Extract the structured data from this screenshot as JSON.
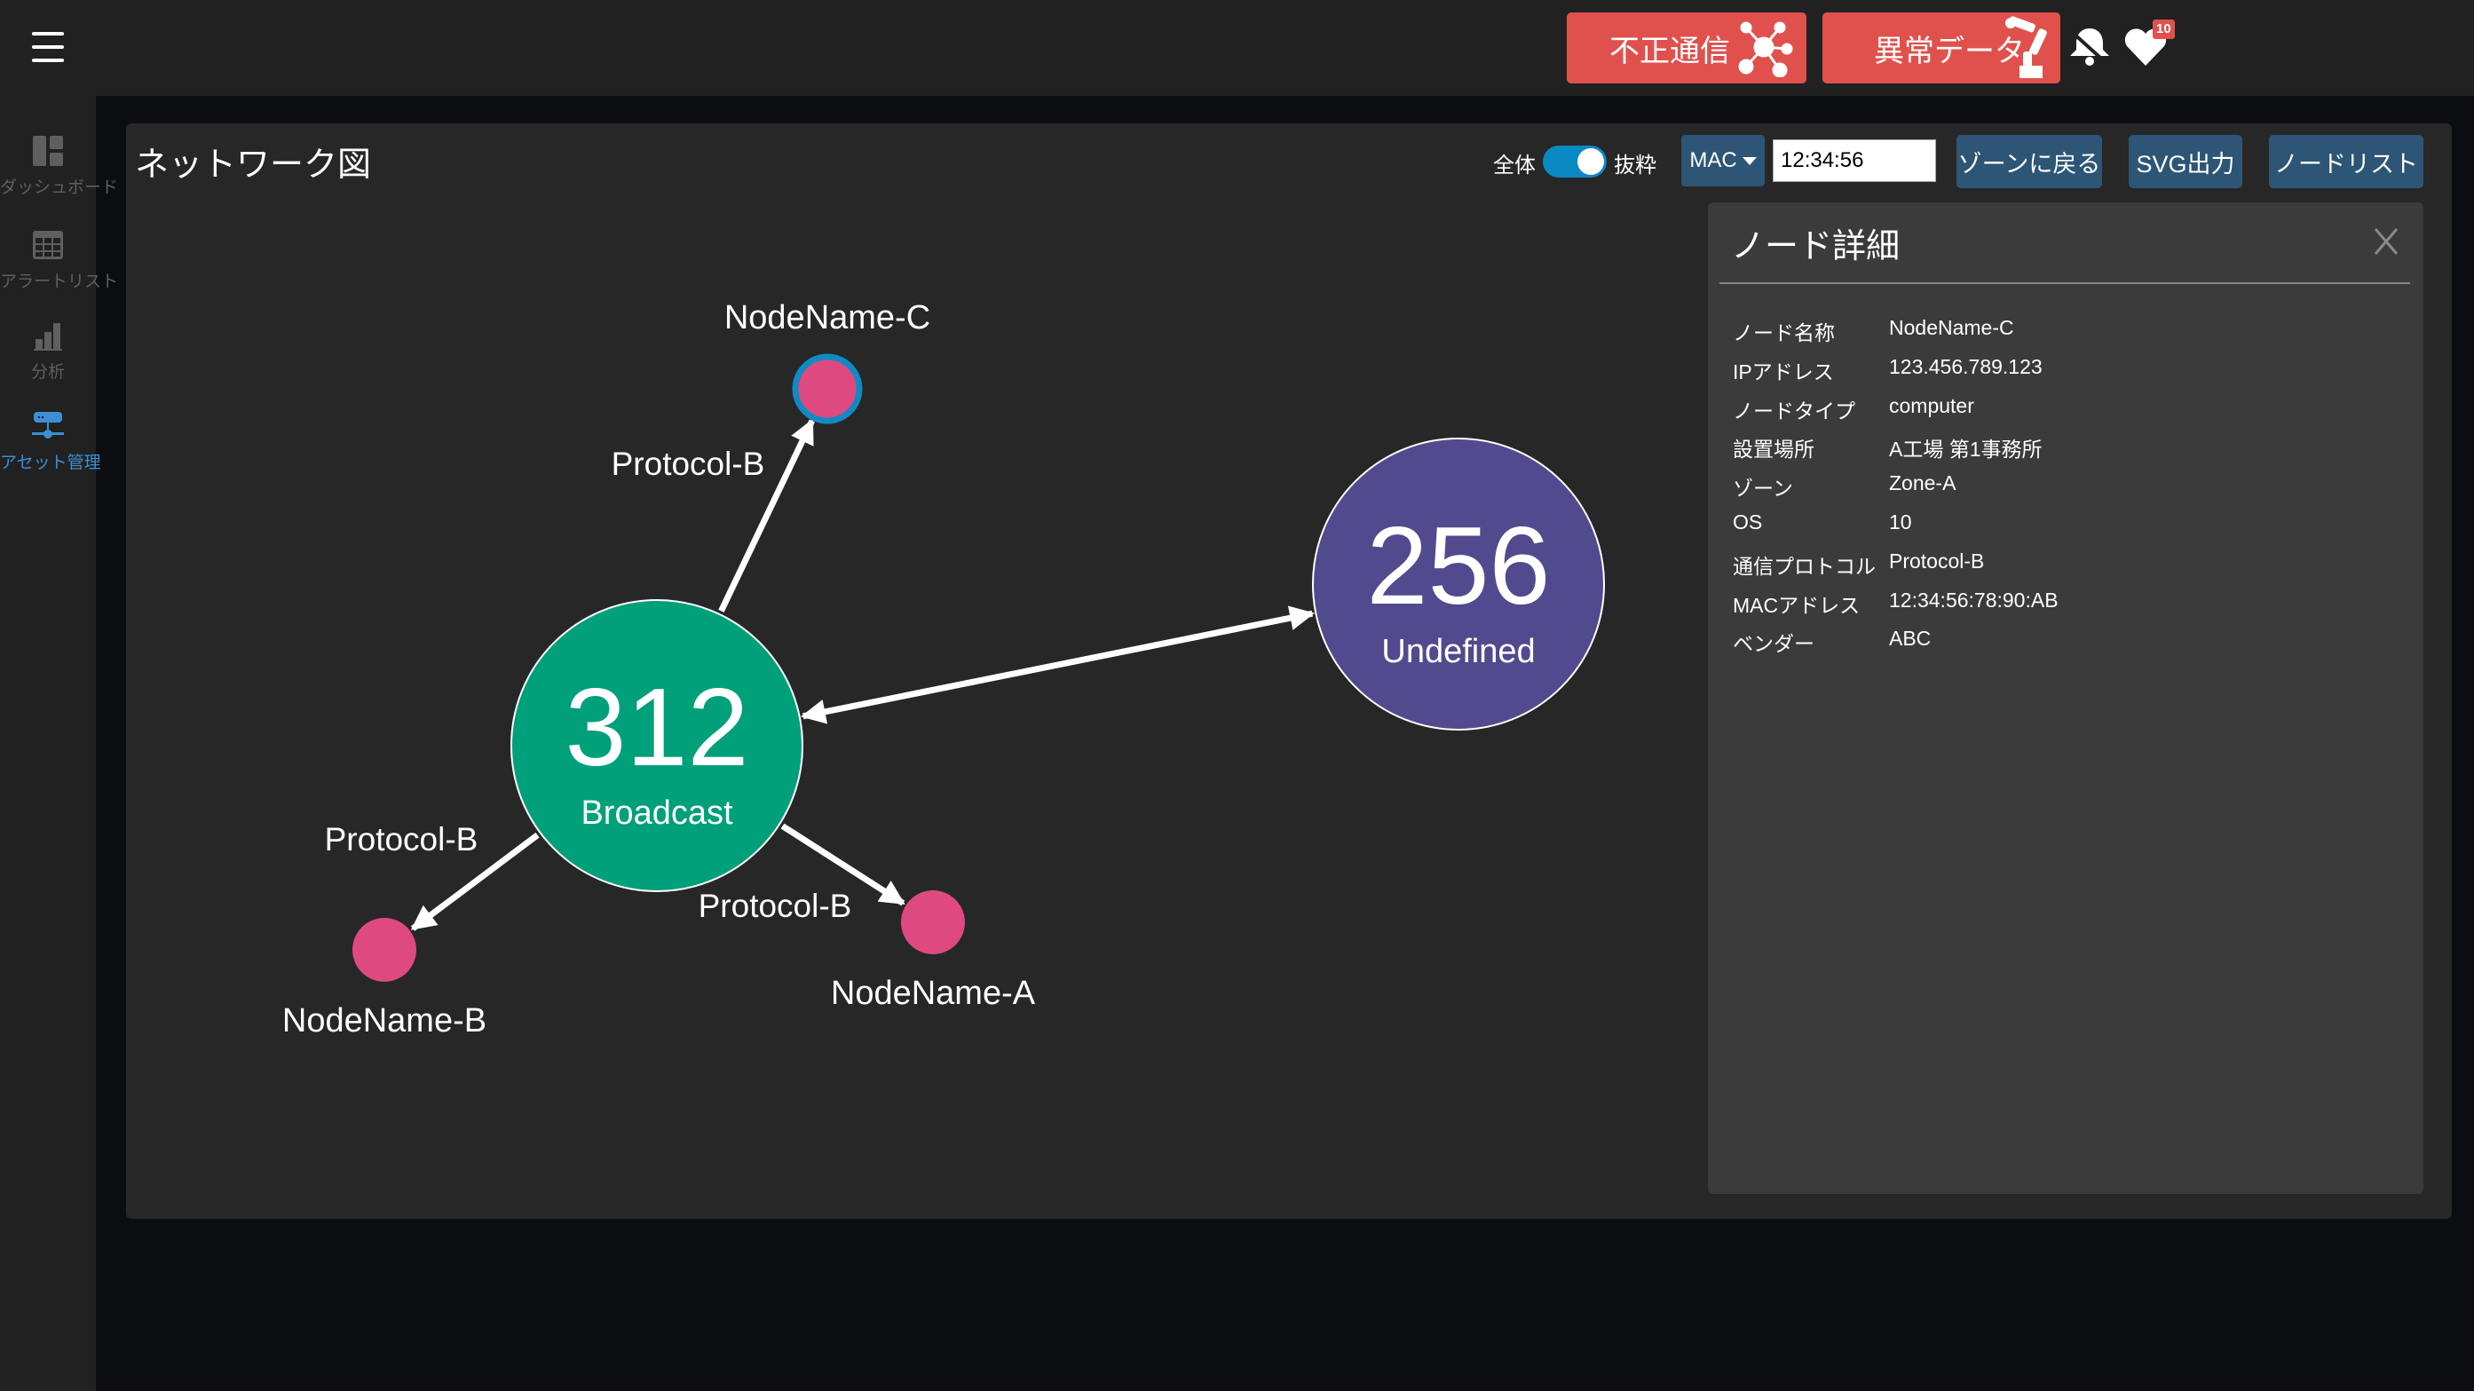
{
  "topbar": {
    "menu_icon": "hamburger-icon",
    "alert_buttons": [
      {
        "label": "不正通信",
        "icon": "network-hub-icon",
        "color": "#e0514d"
      },
      {
        "label": "異常データ",
        "icon": "robot-arm-icon",
        "color": "#e0514d"
      }
    ],
    "notifications_icon": "bell-slash-icon",
    "favorites_icon": "heart-icon",
    "favorites_badge": "10"
  },
  "sidebar": {
    "items": [
      {
        "label": "ダッシュボード",
        "icon": "dashboard-icon",
        "active": false
      },
      {
        "label": "アラートリスト",
        "icon": "table-icon",
        "active": false
      },
      {
        "label": "分析",
        "icon": "bar-chart-icon",
        "active": false
      },
      {
        "label": "アセット管理",
        "icon": "network-server-icon",
        "active": true
      }
    ],
    "active_color": "#3c8fd4"
  },
  "main": {
    "title": "ネットワーク図",
    "toolbar": {
      "toggle_left_label": "全体",
      "toggle_right_label": "抜粋",
      "toggle_state": "抜粋",
      "filter_select": "MAC",
      "filter_value": "12:34:56",
      "zone_back_label": "ゾーンに戻る",
      "svg_export_label": "SVG出力",
      "node_list_label": "ノードリスト"
    }
  },
  "graph": {
    "hubs": [
      {
        "id": "broadcast",
        "count": "312",
        "label": "Broadcast",
        "color": "#00a07a"
      },
      {
        "id": "undefined",
        "count": "256",
        "label": "Undefined",
        "color": "#524a8e"
      }
    ],
    "nodes": [
      {
        "id": "C",
        "label": "NodeName-C",
        "color": "#de4a80",
        "selected": true,
        "ring_color": "#118ac4"
      },
      {
        "id": "A",
        "label": "NodeName-A",
        "color": "#de4a80",
        "selected": false
      },
      {
        "id": "B",
        "label": "NodeName-B",
        "color": "#de4a80",
        "selected": false
      }
    ],
    "edges": [
      {
        "from": "broadcast",
        "to": "C",
        "label": "Protocol-B",
        "direction": "forward"
      },
      {
        "from": "broadcast",
        "to": "A",
        "label": "Protocol-B",
        "direction": "forward"
      },
      {
        "from": "broadcast",
        "to": "B",
        "label": "Protocol-B",
        "direction": "forward"
      },
      {
        "from": "broadcast",
        "to": "undefined",
        "label": "",
        "direction": "both"
      }
    ]
  },
  "detail": {
    "title": "ノード詳細",
    "close_icon": "close-icon",
    "rows": [
      {
        "key": "ノード名称",
        "value": "NodeName-C"
      },
      {
        "key": "IPアドレス",
        "value": "123.456.789.123"
      },
      {
        "key": "ノードタイプ",
        "value": "computer"
      },
      {
        "key": "設置場所",
        "value": "A工場 第1事務所"
      },
      {
        "key": "ゾーン",
        "value": "Zone-A"
      },
      {
        "key": "OS",
        "value": "10"
      },
      {
        "key": "通信プロトコル",
        "value": "Protocol-B"
      },
      {
        "key": "MACアドレス",
        "value": "12:34:56:78:90:AB"
      },
      {
        "key": "ベンダー",
        "value": "ABC"
      }
    ]
  }
}
